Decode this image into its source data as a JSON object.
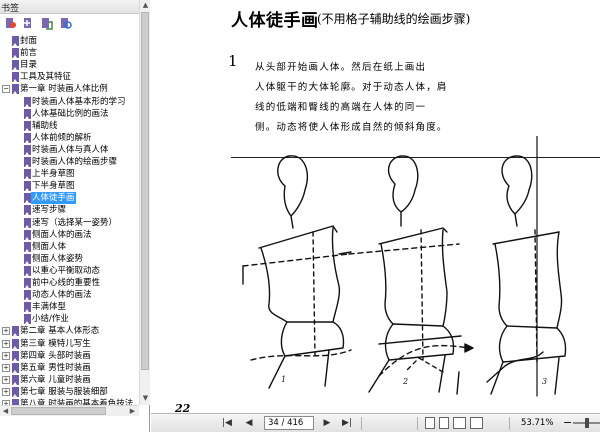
{
  "panel": {
    "title": "书签",
    "close_glyph": "✕",
    "tools": [
      {
        "icon": "options-icon"
      },
      {
        "icon": "expand-bookmark-icon"
      },
      {
        "icon": "add-bookmark-icon"
      },
      {
        "icon": "find-bookmark-icon"
      }
    ],
    "bookmarks": [
      {
        "label": "封面",
        "level": 0,
        "toggle": ""
      },
      {
        "label": "前言",
        "level": 0,
        "toggle": ""
      },
      {
        "label": "目录",
        "level": 0,
        "toggle": ""
      },
      {
        "label": "工具及其特征",
        "level": 0,
        "toggle": ""
      },
      {
        "label": "第一章 时装画人体比例",
        "level": 0,
        "toggle": "−"
      },
      {
        "label": "时装画人体基本形的学习",
        "level": 1,
        "toggle": ""
      },
      {
        "label": "人体基础比例的画法",
        "level": 1,
        "toggle": ""
      },
      {
        "label": "辅助线",
        "level": 1,
        "toggle": ""
      },
      {
        "label": "人体前倾的解析",
        "level": 1,
        "toggle": ""
      },
      {
        "label": "时装画人体与真人体",
        "level": 1,
        "toggle": ""
      },
      {
        "label": "时装画人体的绘画步骤",
        "level": 1,
        "toggle": ""
      },
      {
        "label": "上半身草图",
        "level": 1,
        "toggle": ""
      },
      {
        "label": "下半身草图",
        "level": 1,
        "toggle": ""
      },
      {
        "label": "人体徒手画",
        "level": 1,
        "toggle": "",
        "selected": true
      },
      {
        "label": "速写步骤",
        "level": 1,
        "toggle": ""
      },
      {
        "label": "速写（选择某一姿势）",
        "level": 1,
        "toggle": ""
      },
      {
        "label": "侧面人体的画法",
        "level": 1,
        "toggle": ""
      },
      {
        "label": "侧面人体",
        "level": 1,
        "toggle": ""
      },
      {
        "label": "侧面人体姿势",
        "level": 1,
        "toggle": ""
      },
      {
        "label": "以重心平衡取动态",
        "level": 1,
        "toggle": ""
      },
      {
        "label": "前中心线的重要性",
        "level": 1,
        "toggle": ""
      },
      {
        "label": "动态人体的画法",
        "level": 1,
        "toggle": ""
      },
      {
        "label": "丰满体型",
        "level": 1,
        "toggle": ""
      },
      {
        "label": "小结/作业",
        "level": 1,
        "toggle": ""
      },
      {
        "label": "第二章 基本人体形态",
        "level": 0,
        "toggle": "+"
      },
      {
        "label": "第三章 模特儿写生",
        "level": 0,
        "toggle": "+"
      },
      {
        "label": "第四章 头部时装画",
        "level": 0,
        "toggle": "+"
      },
      {
        "label": "第五章 男性时装画",
        "level": 0,
        "toggle": "+"
      },
      {
        "label": "第六章 儿童时装画",
        "level": 0,
        "toggle": "+"
      },
      {
        "label": "第七章 服装与服装细部",
        "level": 0,
        "toggle": "+"
      },
      {
        "label": "第八章 时装画的基本着色技法",
        "level": 0,
        "toggle": "+"
      }
    ]
  },
  "document": {
    "title_main": "人体徒手画",
    "title_sub": "(不用格子辅助线的绘画步骤)",
    "step_number": "1",
    "body_lines": [
      "从头部开始画人体。然后在纸上画出",
      "人体躯干的大体轮廓。对于动态人体，肩",
      "线的低端和臀线的高端在人体的同一",
      "侧。动态将使人体形成自然的倾斜角度。"
    ],
    "figure_labels": [
      "1",
      "2",
      "3"
    ],
    "printed_page_number": "22"
  },
  "toolbar": {
    "first_page_glyph": "|◀",
    "prev_page_glyph": "◀",
    "next_page_glyph": "▶",
    "last_page_glyph": "▶|",
    "page_field": "34 / 416",
    "zoom": "53.71%",
    "zoom_minus": "−"
  },
  "colors": {
    "bookmark_icon": "#6e5aa8",
    "selection": "#3399ff"
  }
}
